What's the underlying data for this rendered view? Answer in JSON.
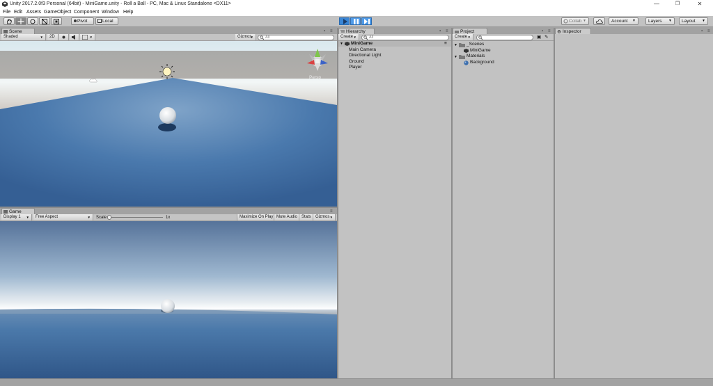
{
  "window": {
    "title": "Unity 2017.2.0f3 Personal (64bit) - MiniGame.unity - Roll a Ball - PC, Mac & Linux Standalone <DX11>",
    "minimize": "—",
    "restore": "❐",
    "close": "✕"
  },
  "menu": [
    "File",
    "Edit",
    "Assets",
    "GameObject",
    "Component",
    "Window",
    "Help"
  ],
  "toolbar": {
    "pivot": "Pivot",
    "local": "Local",
    "collab": "Collab",
    "account": "Account",
    "layers": "Layers",
    "layout": "Layout"
  },
  "scene": {
    "tab": "Scene",
    "shading": "Shaded",
    "mode2d": "2D",
    "gizmos": "Gizmos",
    "search_placeholder": "All",
    "persp": "Persp"
  },
  "game": {
    "tab": "Game",
    "display": "Display 1",
    "aspect": "Free Aspect",
    "scale_label": "Scale",
    "scale_value": "1x",
    "maximize": "Maximize On Play",
    "mute": "Mute Audio",
    "stats": "Stats",
    "gizmos": "Gizmos"
  },
  "hierarchy": {
    "tab": "Hierarchy",
    "create": "Create",
    "search_placeholder": "All",
    "scene_name": "MiniGame",
    "items": [
      "Main Camera",
      "Directional Light",
      "Ground",
      "Player"
    ]
  },
  "project": {
    "tab": "Project",
    "create": "Create",
    "folders": [
      {
        "name": "_Scenes",
        "children": [
          "MiniGame"
        ]
      },
      {
        "name": "Materials",
        "children": [
          "Background"
        ]
      }
    ]
  },
  "inspector": {
    "tab": "Inspector"
  },
  "colors": {
    "play_blue": "#3a86d6",
    "panel_gray": "#c2c2c2",
    "bg_gray": "#a2a2a2",
    "ground_blue": "#3c6fa8"
  }
}
